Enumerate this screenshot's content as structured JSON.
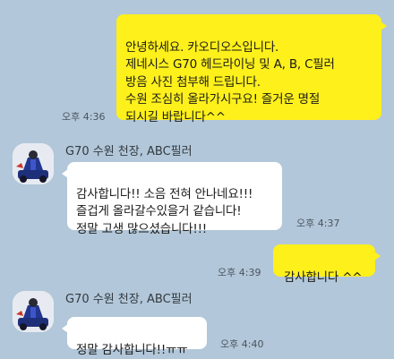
{
  "colors": {
    "background": "#b2c7d9",
    "outgoing_bubble": "#fef01b",
    "incoming_bubble": "#ffffff"
  },
  "messages": [
    {
      "type": "outgoing",
      "text": "안녕하세요. 카오디오스입니다.\n제네시스 G70 헤드라이닝 및 A, B, C필러\n방음 사진 첨부해 드립니다.\n수원 조심히 올라가시구요! 즐거운 명절\n되시길 바랍니다^^",
      "time": "오후 4:36"
    },
    {
      "type": "incoming",
      "sender": "G70 수원 천장, ABC필러",
      "avatar_icon": "car-figure-avatar-icon",
      "text": "감사합니다!! 소음 전혀 안나네요!!!\n즐겁게 올라갈수있을거 같습니다!\n정말 고생 많으셨습니다!!!",
      "time": "오후 4:37"
    },
    {
      "type": "outgoing",
      "text": "감사합니다 ^^",
      "time": "오후 4:39"
    },
    {
      "type": "incoming",
      "sender": "G70 수원 천장, ABC필러",
      "avatar_icon": "car-figure-avatar-icon",
      "text": "정말 감사합니다!!ㅠㅠ",
      "time": "오후 4:40"
    }
  ]
}
